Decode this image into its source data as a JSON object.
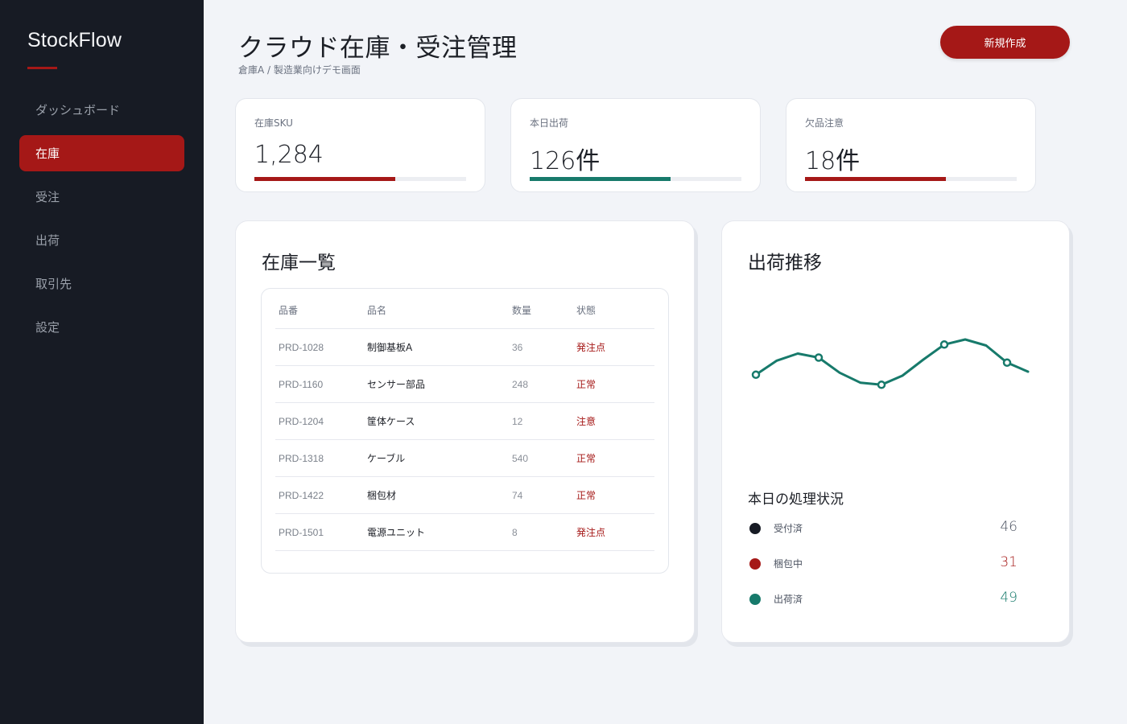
{
  "sidebar": {
    "brand": "StockFlow",
    "items": [
      {
        "label": "ダッシュボード",
        "active": false
      },
      {
        "label": "在庫",
        "active": true
      },
      {
        "label": "受注",
        "active": false
      },
      {
        "label": "出荷",
        "active": false
      },
      {
        "label": "取引先",
        "active": false
      },
      {
        "label": "設定",
        "active": false
      }
    ]
  },
  "header": {
    "title": "クラウド在庫・受注管理",
    "subtitle": "倉庫A / 製造業向けデモ画面",
    "new_button": "新規作成"
  },
  "kpis": [
    {
      "label": "在庫SKU",
      "value": "1,284",
      "progress": 0.665,
      "color": "#a51817"
    },
    {
      "label": "本日出荷",
      "value": "126件",
      "progress": 0.665,
      "color": "#177a6b"
    },
    {
      "label": "欠品注意",
      "value": "18件",
      "progress": 0.665,
      "color": "#a51817"
    }
  ],
  "inventory": {
    "title": "在庫一覧",
    "columns": [
      "品番",
      "品名",
      "数量",
      "状態"
    ],
    "rows": [
      {
        "code": "PRD-1028",
        "name": "制御基板A",
        "qty": "36",
        "status": "発注点"
      },
      {
        "code": "PRD-1160",
        "name": "センサー部品",
        "qty": "248",
        "status": "正常"
      },
      {
        "code": "PRD-1204",
        "name": "筐体ケース",
        "qty": "12",
        "status": "注意"
      },
      {
        "code": "PRD-1318",
        "name": "ケーブル",
        "qty": "540",
        "status": "正常"
      },
      {
        "code": "PRD-1422",
        "name": "梱包材",
        "qty": "74",
        "status": "正常"
      },
      {
        "code": "PRD-1501",
        "name": "電源ユニット",
        "qty": "8",
        "status": "発注点"
      }
    ]
  },
  "shipping": {
    "title": "出荷推移",
    "status_title": "本日の処理状況",
    "status": [
      {
        "label": "受付済",
        "value": "46",
        "color": "#171b24",
        "value_color": "#4b5260"
      },
      {
        "label": "梱包中",
        "value": "31",
        "color": "#a51817",
        "value_color": "#a51817"
      },
      {
        "label": "出荷済",
        "value": "49",
        "color": "#177a6b",
        "value_color": "#177a6b"
      }
    ]
  },
  "chart_data": {
    "type": "line",
    "title": "出荷推移",
    "xlabel": "",
    "ylabel": "",
    "ylim": [
      0,
      100
    ],
    "x": [
      1,
      2,
      3,
      4,
      5,
      6,
      7,
      8,
      9,
      10,
      11,
      12,
      13,
      14
    ],
    "series": [
      {
        "values": [
          45,
          59,
          66,
          62,
          47,
          37,
          35,
          44,
          60,
          75,
          80,
          74,
          57,
          48
        ]
      }
    ],
    "markers_at": [
      1,
      4,
      7,
      10,
      13
    ],
    "grid": false,
    "line_color": "#177a6b"
  }
}
